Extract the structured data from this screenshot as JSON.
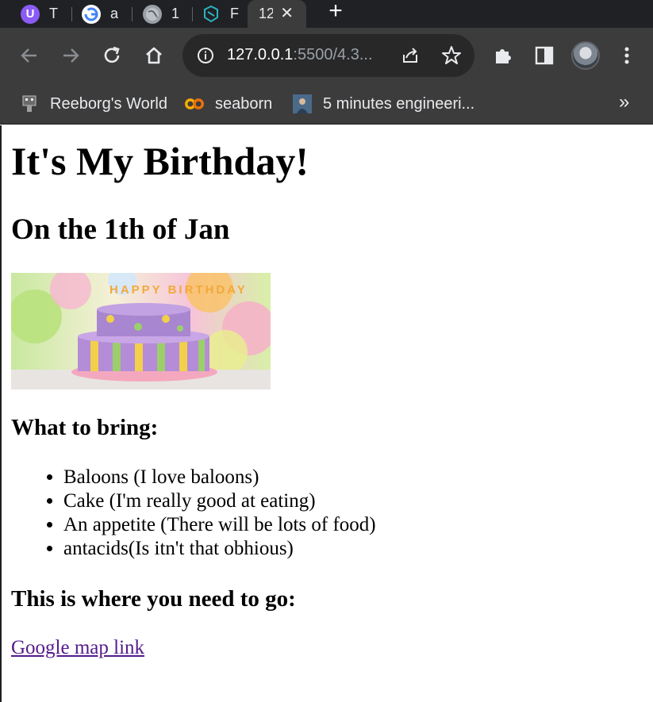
{
  "browser": {
    "tabs": [
      {
        "title": "T",
        "icon": "twitch-like-icon",
        "color": "#8a5cf5"
      },
      {
        "title": "a",
        "icon": "google-icon"
      },
      {
        "title": "1",
        "icon": "globe-icon"
      },
      {
        "title": "F",
        "icon": "cube-icon",
        "color": "#2bb3c0"
      },
      {
        "title": "12",
        "active": true
      }
    ],
    "url": {
      "host": "127.0.0.1",
      "rest": ":5500/4.3..."
    },
    "bookmarks": [
      {
        "label": "Reeborg's World",
        "icon": "robot-icon"
      },
      {
        "label": "seaborn",
        "icon": "colab-icon",
        "color": "#f9ab00"
      },
      {
        "label": "5 minutes engineeri...",
        "icon": "person-thumbnail-icon"
      }
    ],
    "more_bookmarks": "»"
  },
  "page": {
    "title": "It's My Birthday!",
    "date_heading": "On the 1th of Jan",
    "image_text": "HAPPY BIRTHDAY",
    "bring_heading": "What to bring:",
    "bring_items": [
      "Baloons (I love baloons)",
      "Cake (I'm really good at eating)",
      "An appetite (There will be lots of food)",
      "antacids(Is itn't that obhious)"
    ],
    "where_heading": "This is where you need to go:",
    "map_link": "Google map link"
  },
  "colors": {
    "tabstrip": "#202124",
    "toolbar": "#3c3c3c",
    "omnibox": "#282828",
    "visited_link": "#551a8b"
  }
}
